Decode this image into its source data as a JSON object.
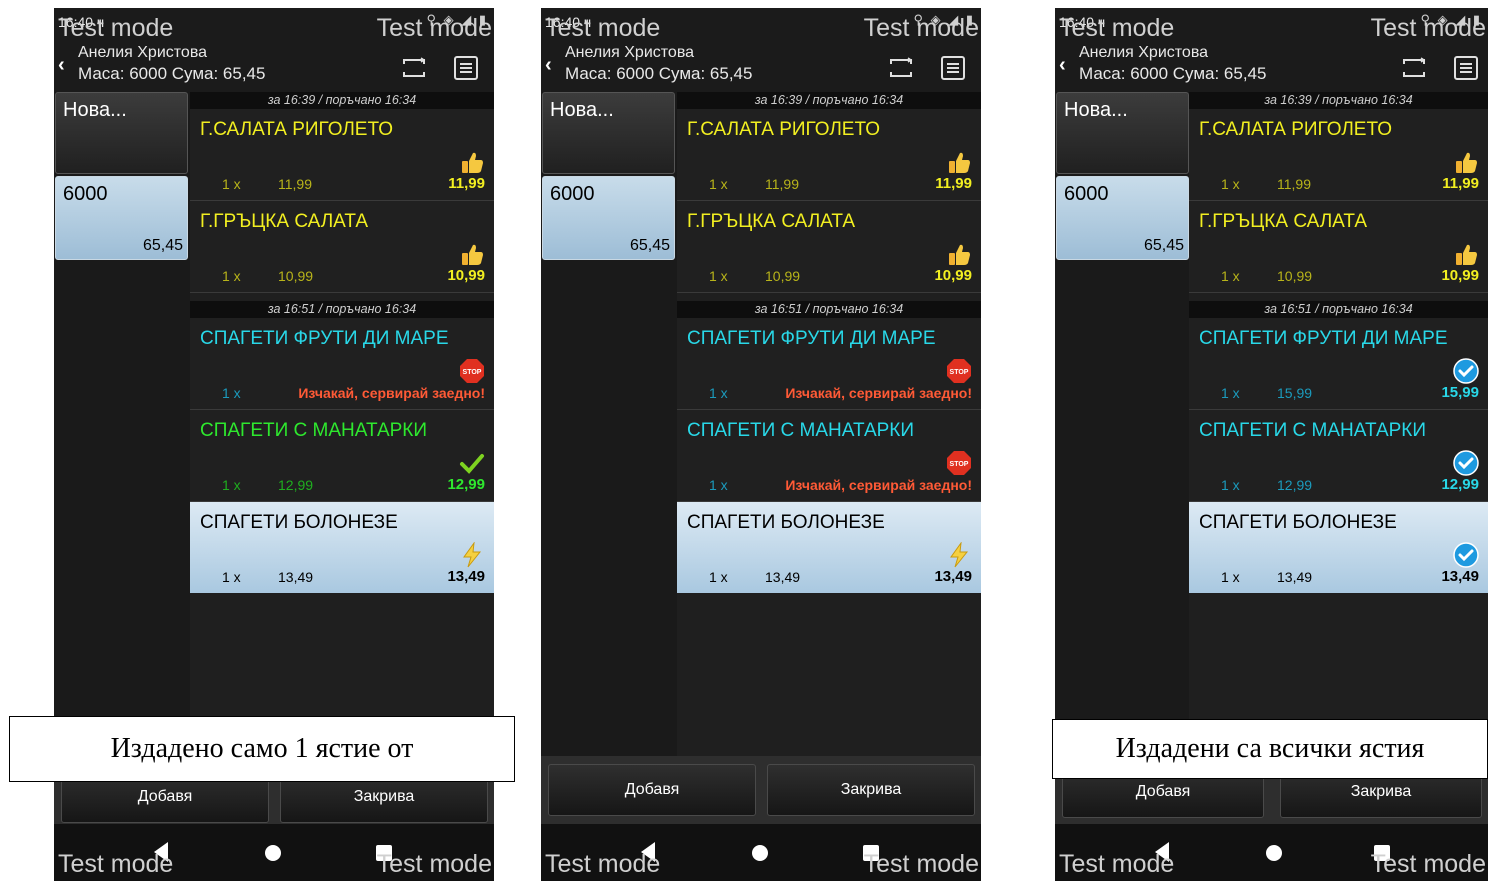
{
  "test_mode": "Test mode",
  "status": {
    "time": "16:40 ч"
  },
  "header": {
    "waiter": "Анелия Христова",
    "table_info": "Маса: 6000 Сума: 65,45"
  },
  "left": {
    "new_label": "Нова...",
    "table_number": "6000",
    "table_sum": "65,45"
  },
  "buttons": {
    "add": "Добавя",
    "close": "Закрива"
  },
  "groups": {
    "g1": "за 16:39 / поръчано 16:34",
    "g2": "за 16:51 / поръчано 16:34"
  },
  "items": {
    "riggoletto": "Г.САЛАТА РИГОЛЕТО",
    "greek": "Г.ГРЪЦКА САЛАТА",
    "frutti": "СПАГЕТИ ФРУТИ ДИ МАРЕ",
    "manatarki": "СПАГЕТИ С МАНАТАРКИ",
    "bolognese": "СПАГЕТИ БОЛОНЕЗЕ"
  },
  "qty": "1 x",
  "prices": {
    "riggoletto": "11,99",
    "greek": "10,99",
    "frutti": "15,99",
    "manatarki": "12,99",
    "bolognese": "13,49"
  },
  "wait_message": "Изчакай, сервирай заедно!",
  "captions": {
    "left": "Издадено само 1 ястие от",
    "right": "Издадени са всички ястия"
  },
  "status_icons": [
    "thumbs-up-icon",
    "stop-icon",
    "check-icon",
    "lightning-icon",
    "check-circle-icon"
  ],
  "colors": {
    "accent_yellow": "#f2ef21",
    "accent_cyan": "#29d8e8",
    "accent_green": "#2ee82e",
    "warning_red": "#ff5a36",
    "selected_bg": "#a9c8e0"
  }
}
